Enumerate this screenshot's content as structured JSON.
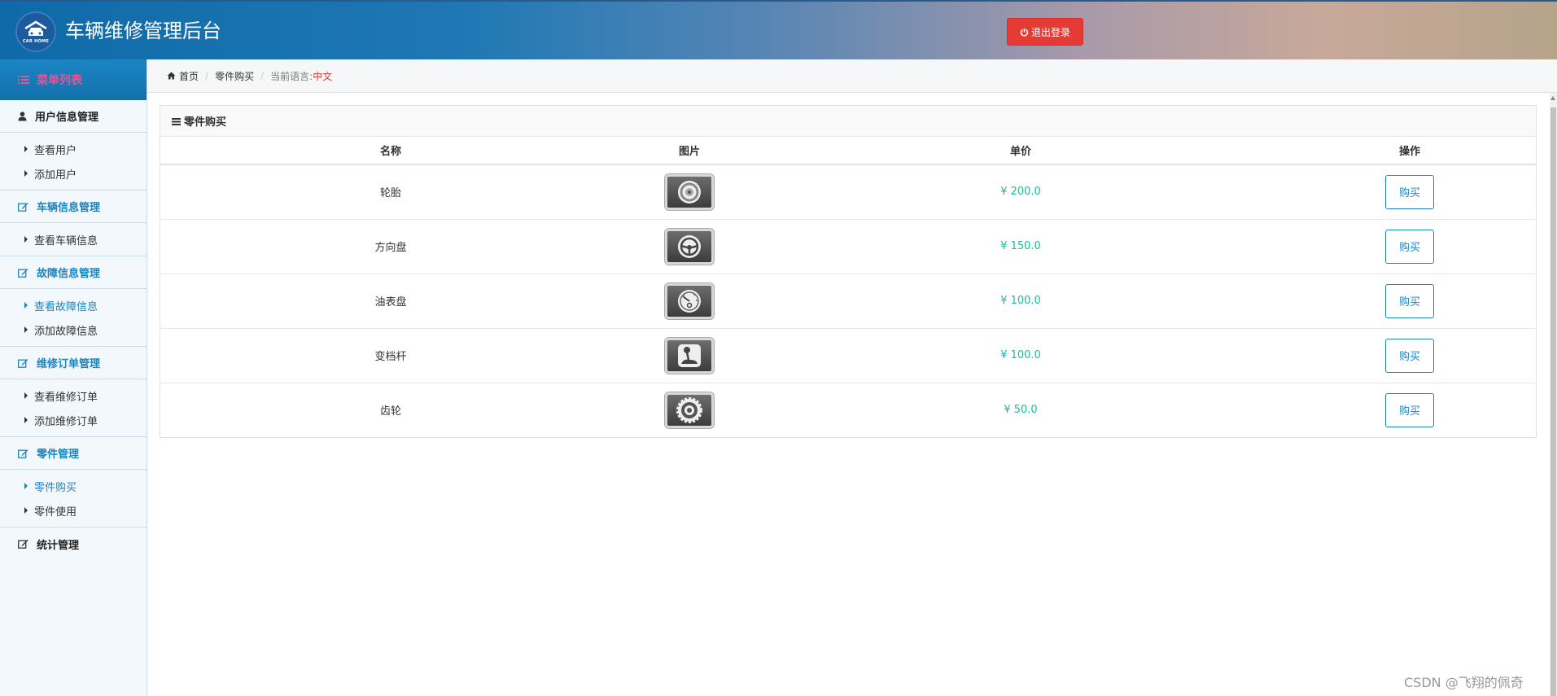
{
  "header": {
    "logo_text": "CAR HOME",
    "title": "车辆维修管理后台",
    "logout_label": "退出登录",
    "logout_color": "#e63a35"
  },
  "sidebar": {
    "menu_title": "菜单列表",
    "groups": [
      {
        "title": "用户信息管理",
        "icon": "user-icon",
        "items": [
          {
            "label": "查看用户"
          },
          {
            "label": "添加用户"
          }
        ]
      },
      {
        "title": "车辆信息管理",
        "icon": "edit-icon",
        "items": [
          {
            "label": "查看车辆信息"
          }
        ]
      },
      {
        "title": "故障信息管理",
        "icon": "edit-icon",
        "items": [
          {
            "label": "查看故障信息"
          },
          {
            "label": "添加故障信息"
          }
        ]
      },
      {
        "title": "维修订单管理",
        "icon": "edit-icon",
        "items": [
          {
            "label": "查看维修订单"
          },
          {
            "label": "添加维修订单"
          }
        ]
      },
      {
        "title": "零件管理",
        "icon": "edit-icon",
        "items": [
          {
            "label": "零件购买"
          },
          {
            "label": "零件使用"
          }
        ]
      },
      {
        "title": "统计管理",
        "icon": "edit-icon",
        "items": []
      }
    ]
  },
  "breadcrumb": {
    "home": "首页",
    "current": "零件购买",
    "lang_label": "当前语言:",
    "lang_value": "中文"
  },
  "panel": {
    "title": "零件购买",
    "columns": [
      "名称",
      "图片",
      "单价",
      "操作"
    ],
    "rows": [
      {
        "name": "轮胎",
        "image_icon": "tire-icon",
        "price": "¥ 200.0",
        "action": "购买"
      },
      {
        "name": "方向盘",
        "image_icon": "steering-wheel-icon",
        "price": "¥ 150.0",
        "action": "购买"
      },
      {
        "name": "油表盘",
        "image_icon": "fuel-gauge-icon",
        "price": "¥ 100.0",
        "action": "购买"
      },
      {
        "name": "变档杆",
        "image_icon": "gear-shift-icon",
        "price": "¥ 100.0",
        "action": "购买"
      },
      {
        "name": "齿轮",
        "image_icon": "gear-icon",
        "price": "¥ 50.0",
        "action": "购买"
      }
    ]
  },
  "watermark": "CSDN @飞翔的佩奇",
  "colors": {
    "accent": "#1b85c1",
    "price": "#1bbc9b",
    "menu_title": "#e2559a"
  }
}
